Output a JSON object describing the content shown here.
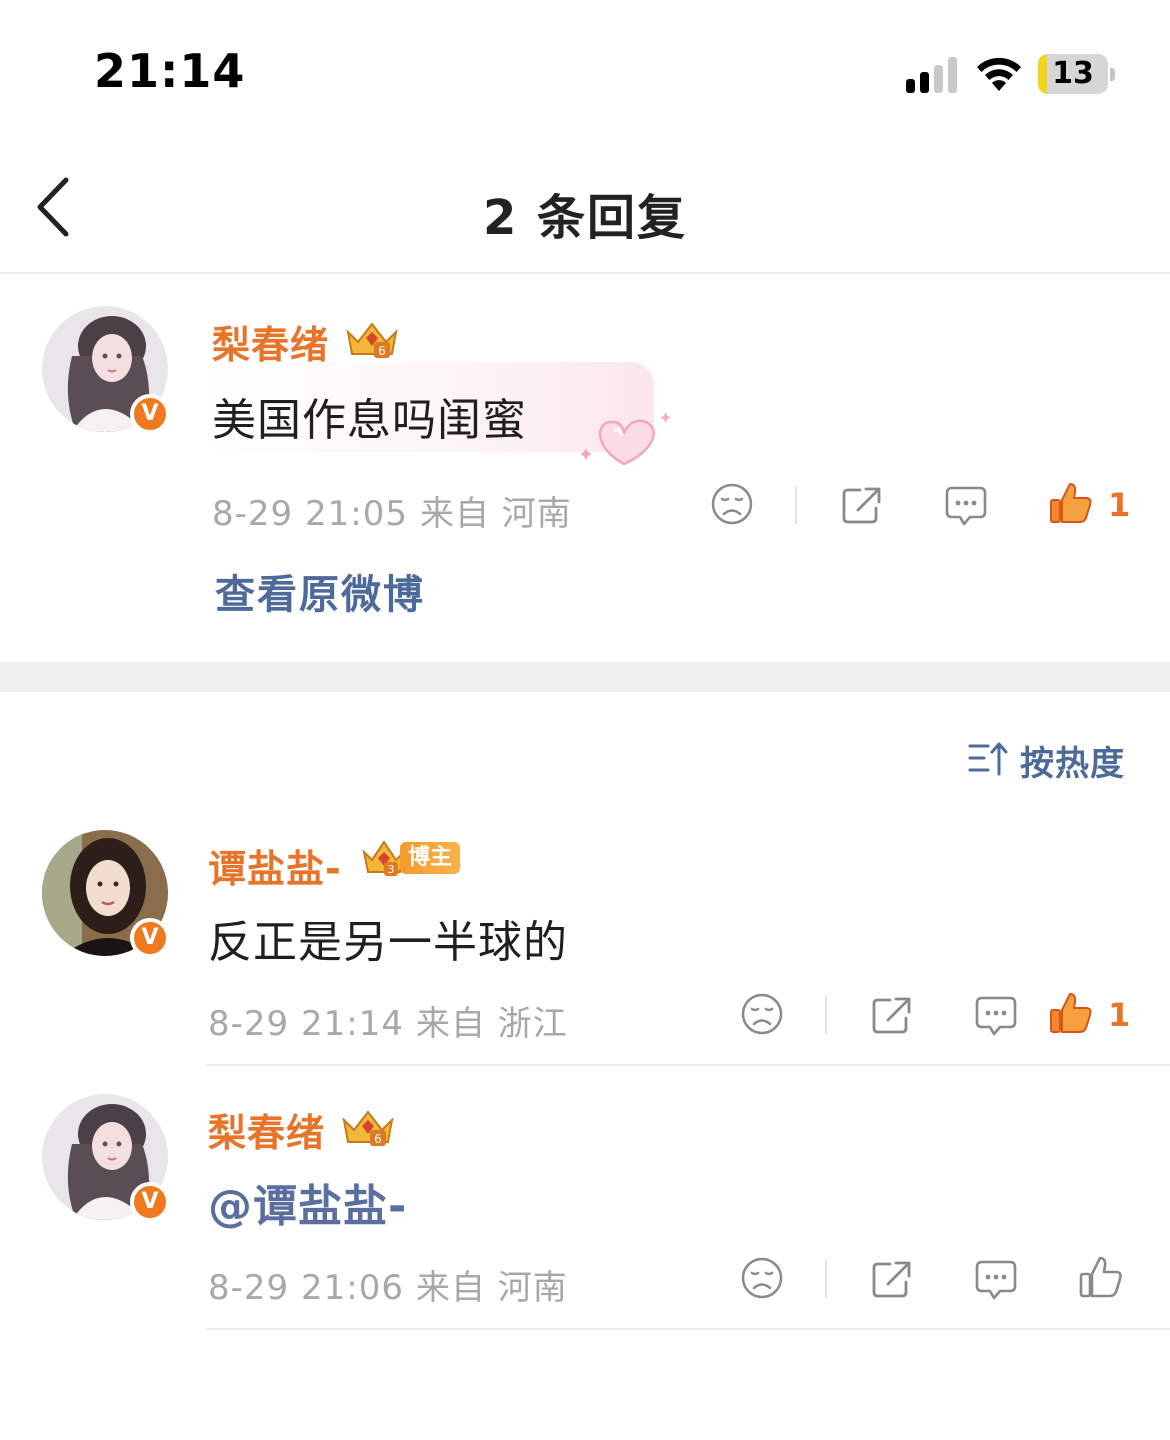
{
  "status_bar": {
    "time": "21:14",
    "battery": "13",
    "battery_level": 0.13
  },
  "nav": {
    "title": "2 条回复"
  },
  "root_comment": {
    "username": "梨春绪",
    "text": "美国作息吗闺蜜",
    "date": "8-29 21:05",
    "location": "来自 河南",
    "likes": "1"
  },
  "view_original_label": "查看原微博",
  "sort": {
    "label": "按热度"
  },
  "replies": [
    {
      "username": "谭盐盐-",
      "badge": "博主",
      "text": "反正是另一半球的",
      "date": "8-29 21:14",
      "location": "来自 浙江",
      "likes": "1"
    },
    {
      "username": "梨春绪",
      "mention": "@谭盐盐-",
      "date": "8-29 21:06",
      "location": "来自 河南"
    }
  ],
  "colors": {
    "accent": "#e8742a",
    "link": "#4e6a9a",
    "meta": "#a8a8a8"
  }
}
